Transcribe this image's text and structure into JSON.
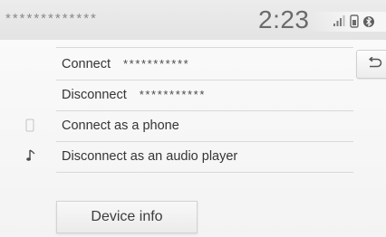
{
  "header": {
    "title": "*************",
    "clock": "2:23"
  },
  "status_icons": [
    "signal-bars-icon",
    "phone-battery-icon",
    "bluetooth-icon"
  ],
  "list": [
    {
      "label": "Connect",
      "value": "***********",
      "icon": null
    },
    {
      "label": "Disconnect",
      "value": "***********",
      "icon": null
    },
    {
      "label": "Connect as a phone",
      "value": "",
      "icon": "phone-icon"
    },
    {
      "label": "Disconnect as an audio player",
      "value": "",
      "icon": "music-note-icon"
    }
  ],
  "buttons": {
    "back": "back-arrow-icon",
    "device_info": "Device info"
  },
  "colors": {
    "background": "#f7f7f7",
    "header": "#e8e8e8",
    "text": "#353535",
    "divider": "#d8d8d8"
  }
}
